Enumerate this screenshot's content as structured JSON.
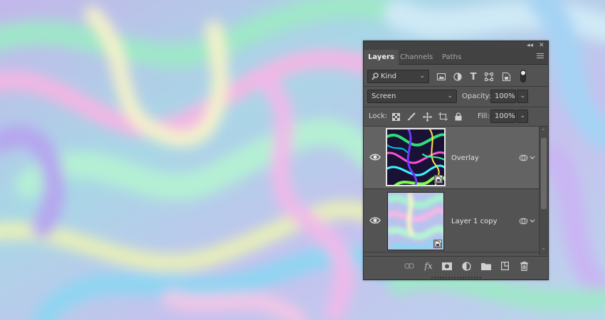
{
  "panel": {
    "collapse_glyph": "◂◂",
    "close_glyph": "✕",
    "tabs": [
      {
        "label": "Layers",
        "active": true
      },
      {
        "label": "Channels",
        "active": false
      },
      {
        "label": "Paths",
        "active": false
      }
    ]
  },
  "filter": {
    "label": "Kind",
    "icons": [
      "image-filter-icon",
      "adjustment-filter-icon",
      "type-filter-icon",
      "shape-filter-icon",
      "smart-object-filter-icon",
      "filter-toggle-icon"
    ]
  },
  "blend": {
    "mode": "Screen",
    "opacity_label": "Opacity:",
    "opacity_value": "100%"
  },
  "lock": {
    "label": "Lock:",
    "fill_label": "Fill:",
    "fill_value": "100%",
    "icons": [
      "lock-transparent-icon",
      "lock-image-icon",
      "lock-position-icon",
      "lock-artboard-icon",
      "lock-all-icon"
    ]
  },
  "layers": [
    {
      "name": "Overlay",
      "selected": true,
      "visible": true
    },
    {
      "name": "Layer 1 copy",
      "selected": false,
      "visible": true
    }
  ],
  "bottom_icons": [
    "link-layers-icon",
    "fx-icon",
    "add-mask-icon",
    "adjustment-layer-icon",
    "new-group-icon",
    "new-layer-icon",
    "delete-layer-icon"
  ],
  "fx_label": "fx",
  "colors": {
    "panel_bg": "#535353",
    "selected_layer": "#636363"
  }
}
